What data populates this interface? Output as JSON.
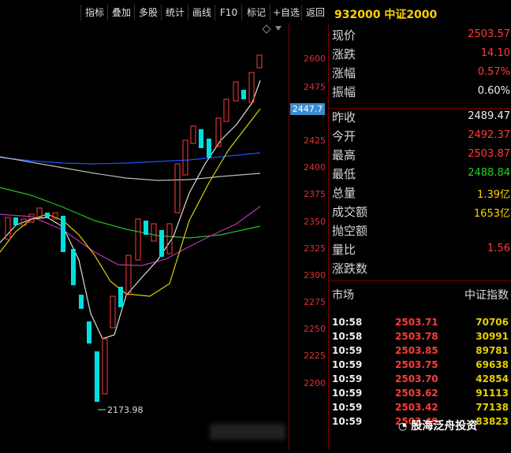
{
  "toolbar": {
    "items": [
      "指标",
      "叠加",
      "多股",
      "统计",
      "画线",
      "F10",
      "标记",
      "+自选",
      "返回"
    ]
  },
  "stock": {
    "code_name": "932000 中证2000"
  },
  "price_axis": {
    "labels": [
      "2600",
      "2475",
      "2425",
      "2400",
      "2375",
      "2350",
      "2325",
      "2300",
      "2275",
      "2250",
      "2225",
      "2200"
    ],
    "current": "2447.7"
  },
  "chart_annotation": {
    "low_label": "2173.98"
  },
  "quote": [
    {
      "label": "现价",
      "value": "2503.57",
      "color": "red"
    },
    {
      "label": "涨跌",
      "value": "14.10",
      "color": "red"
    },
    {
      "label": "涨幅",
      "value": "0.57%",
      "color": "red"
    },
    {
      "label": "振幅",
      "value": "0.60%",
      "color": "white"
    },
    {
      "label": "昨收",
      "value": "2489.47",
      "color": "white"
    },
    {
      "label": "今开",
      "value": "2492.37",
      "color": "red"
    },
    {
      "label": "最高",
      "value": "2503.87",
      "color": "red"
    },
    {
      "label": "最低",
      "value": "2488.84",
      "color": "green"
    },
    {
      "label": "总量",
      "value": "1.39亿",
      "color": "yellow"
    },
    {
      "label": "成交额",
      "value": "1653亿",
      "color": "yellow"
    },
    {
      "label": "抛空额",
      "value": "",
      "color": "white"
    },
    {
      "label": "量比",
      "value": "1.56",
      "color": "red"
    },
    {
      "label": "涨跌数",
      "value": "",
      "color": "white"
    }
  ],
  "ticks": {
    "header_left": "市场",
    "header_right": "中证指数",
    "rows": [
      {
        "time": "10:58",
        "price": "2503.71",
        "vol": "70706"
      },
      {
        "time": "10:58",
        "price": "2503.78",
        "vol": "30991"
      },
      {
        "time": "10:59",
        "price": "2503.85",
        "vol": "89781"
      },
      {
        "time": "10:59",
        "price": "2503.75",
        "vol": "69638"
      },
      {
        "time": "10:59",
        "price": "2503.70",
        "vol": "42854"
      },
      {
        "time": "10:59",
        "price": "2503.62",
        "vol": "91113"
      },
      {
        "time": "10:59",
        "price": "2503.42",
        "vol": "77138"
      },
      {
        "time": "10:59",
        "price": "2503.49",
        "vol": "83823"
      }
    ]
  },
  "watermark": {
    "text": "股海泛舟投资"
  },
  "colors": {
    "up": "#ff3b3b",
    "down": "#00e0e0",
    "accent": "#ffd200",
    "border": "#7a0000"
  }
}
